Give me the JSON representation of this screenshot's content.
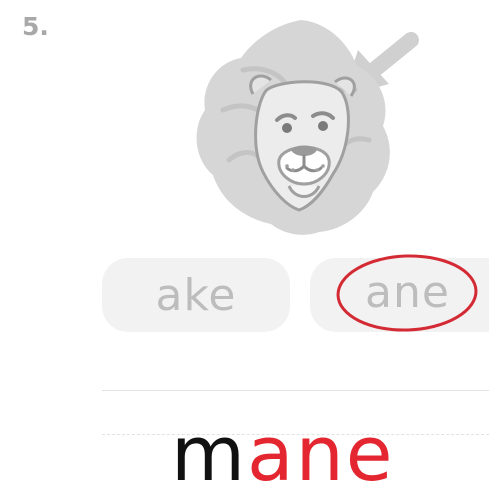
{
  "question": {
    "number": "5."
  },
  "illustration": {
    "icon": "lion-icon",
    "colors": {
      "mane": "#d6d6d6",
      "face": "#ececec",
      "outline": "#9a9a9a",
      "arrow": "#d0d0d0"
    }
  },
  "options": [
    {
      "label": "ake",
      "selected": false
    },
    {
      "label": "ane",
      "selected": true
    }
  ],
  "selection_mark": {
    "color": "#d32a34"
  },
  "answer": {
    "prefix": "m",
    "suffix": "ane",
    "prefix_color": "#111111",
    "suffix_color": "#e3262f"
  }
}
